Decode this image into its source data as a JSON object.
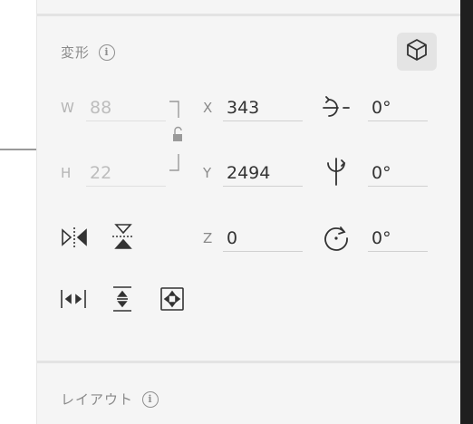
{
  "transform_section": {
    "title": "変形",
    "width_label": "W",
    "width_value": "88",
    "height_label": "H",
    "height_value": "22",
    "x_label": "X",
    "x_value": "343",
    "y_label": "Y",
    "y_value": "2494",
    "z_label": "Z",
    "z_value": "0",
    "rotation_x_value": "0°",
    "rotation_y_value": "0°",
    "rotation_z_value": "0°"
  },
  "layout_section": {
    "title": "レイアウト"
  },
  "colors": {
    "panel_background": "#f5f5f5",
    "label_gray": "#8a8a8a",
    "value_text": "#333333"
  }
}
